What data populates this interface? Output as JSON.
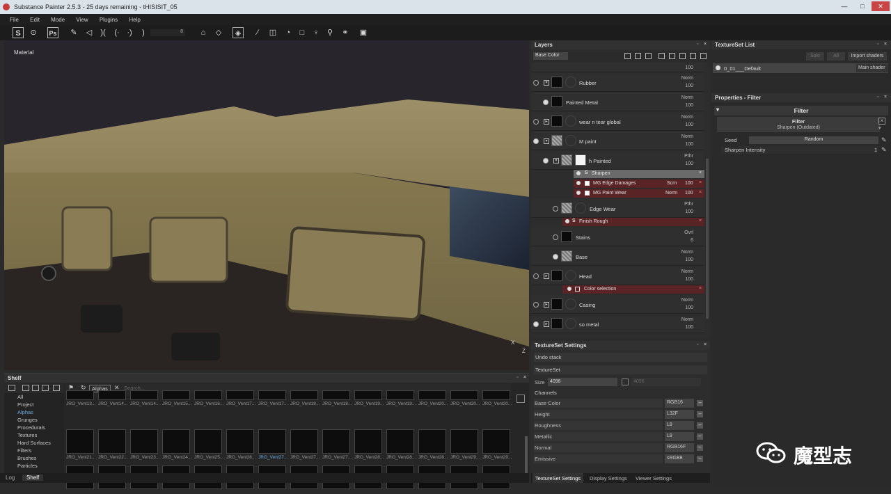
{
  "window": {
    "title": "Substance Painter 2.5.3 - 25 days remaining - tHISISIT_05",
    "controls": [
      "—",
      "□",
      "✕"
    ]
  },
  "menu": [
    "File",
    "Edit",
    "Mode",
    "View",
    "Plugins",
    "Help"
  ],
  "toolbar": {
    "brush_size": "8"
  },
  "viewport": {
    "label": "Material",
    "axis_x": "X",
    "axis_z": "Z"
  },
  "shelf": {
    "title": "Shelf",
    "filter_tag": "Alphas",
    "search_placeholder": "Search...",
    "categories": [
      "All",
      "Project",
      "Alphas",
      "Grunges",
      "Procedurals",
      "Textures",
      "Hard Surfaces",
      "Filters",
      "Brushes",
      "Particles"
    ],
    "selected_category": "Alphas",
    "row1_labels": [
      "JRO_Vent13...",
      "JRO_Vent14...",
      "JRO_Vent14...",
      "JRO_Vent15...",
      "JRO_Vent16...",
      "JRO_Vent17...",
      "JRO_Vent17...",
      "JRO_Vent18...",
      "JRO_Vent18...",
      "JRO_Vent19...",
      "JRO_Vent19...",
      "JRO_Vent20...",
      "JRO_Vent20...",
      "JRO_Vent20..."
    ],
    "row2_labels": [
      "JRO_Vent21...",
      "JRO_Vent22...",
      "JRO_Vent23...",
      "JRO_Vent24...",
      "JRO_Vent25...",
      "JRO_Vent26...",
      "JRO_Vent27...",
      "JRO_Vent27...",
      "JRO_Vent27...",
      "JRO_Vent28...",
      "JRO_Vent28...",
      "JRO_Vent28...",
      "JRO_Vent29...",
      "JRO_Vent29..."
    ],
    "selected_thumb_label": "JRO_Vent27..."
  },
  "bottom_tabs": [
    "Log",
    "Shelf"
  ],
  "layers": {
    "title": "Layers",
    "channel": "Base Color",
    "top_opacity": "100",
    "rows": [
      {
        "name": "Rubber",
        "blend": "Norm",
        "opacity": "100"
      },
      {
        "name": "Painted Metal",
        "blend": "Norm",
        "opacity": "100"
      },
      {
        "name": "wear n tear global",
        "blend": "Norm",
        "opacity": "100"
      },
      {
        "name": "M paint",
        "blend": "Norm",
        "opacity": "100"
      },
      {
        "name": "h Painted",
        "blend": "Pthr",
        "opacity": "100"
      },
      {
        "name": "Edge Wear",
        "blend": "Pthr",
        "opacity": "100"
      },
      {
        "name": "Stains",
        "blend": "Ovrl",
        "opacity": "6"
      },
      {
        "name": "Base",
        "blend": "Norm",
        "opacity": "100"
      },
      {
        "name": "Head",
        "blend": "Norm",
        "opacity": "100"
      },
      {
        "name": "Casing",
        "blend": "Norm",
        "opacity": "100"
      },
      {
        "name": "so metal",
        "blend": "Norm",
        "opacity": "100"
      }
    ],
    "effects": {
      "sharpen": "Sharpen",
      "edge_damages": {
        "name": "MG Edge Damages",
        "blend": "Scrn",
        "opacity": "100"
      },
      "paint_wear": {
        "name": "MG Paint Wear",
        "blend": "Norm",
        "opacity": "100"
      },
      "finish_rough": "Finish Rough",
      "color_selection": "Color selection"
    }
  },
  "textureset_settings": {
    "title": "TextureSet Settings",
    "undo_stack": "Undo stack",
    "textureset": "TextureSet",
    "size_label": "Size",
    "size_value": "4096",
    "size_value2": "4096",
    "channels_label": "Channels",
    "channels": [
      {
        "name": "Base Color",
        "format": "RGB16"
      },
      {
        "name": "Height",
        "format": "L32F"
      },
      {
        "name": "Roughness",
        "format": "L8"
      },
      {
        "name": "Metallic",
        "format": "L8"
      },
      {
        "name": "Normal",
        "format": "RGB16F"
      },
      {
        "name": "Emissive",
        "format": "sRGB8"
      }
    ],
    "tabs": [
      "TextureSet Settings",
      "Display Settings",
      "Viewer Settings"
    ]
  },
  "textureset_list": {
    "title": "TextureSet List",
    "btn_solo": "Solo",
    "btn_all": "All",
    "btn_import": "Import shaders",
    "item": "0_01___Default",
    "shader": "Main shader"
  },
  "properties": {
    "title": "Properties - Filter",
    "section": "Filter",
    "filter_label": "Filter",
    "filter_name": "Sharpen (Outdated)",
    "seed_label": "Seed",
    "seed_value": "Random",
    "intensity_label": "Sharpen Intensity",
    "intensity_value": "1"
  },
  "watermark": {
    "text": "魔型志"
  }
}
